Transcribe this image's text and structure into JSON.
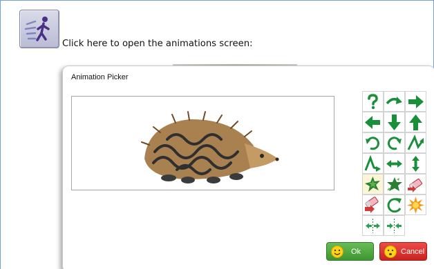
{
  "page": {
    "instruction_text": "Click here to open the animations screen:",
    "launch_button_icon": "animated-figure-icon"
  },
  "dialog": {
    "title": "Animation Picker",
    "preview_icon": "hedgehog-image",
    "animation_icons": [
      "help-question-icon",
      "curve-arrow-right-icon",
      "arrow-right-icon",
      "arrow-left-icon",
      "arrow-down-icon",
      "arrow-up-icon",
      "rotate-clockwise-icon",
      "rotate-counterclockwise-icon",
      "zigzag-right-icon",
      "zigzag-left-icon",
      "horizontal-stretch-icon",
      "vertical-stretch-icon",
      "leaves-spin-icon",
      "leaves-burst-icon",
      "eraser-fade-out-icon",
      "eraser-fade-in-icon",
      "partial-rotate-icon",
      "starburst-icon",
      "wipe-horizontal-icon",
      "wipe-vertical-icon"
    ],
    "selected_index": 12,
    "ok_label": "Ok",
    "cancel_label": "Cancel"
  },
  "colors": {
    "icon_green": "#1a8f3a",
    "ok_green": "#4ea93f",
    "cancel_red": "#e0332e",
    "emoji_yellow": "#ffd21a"
  }
}
